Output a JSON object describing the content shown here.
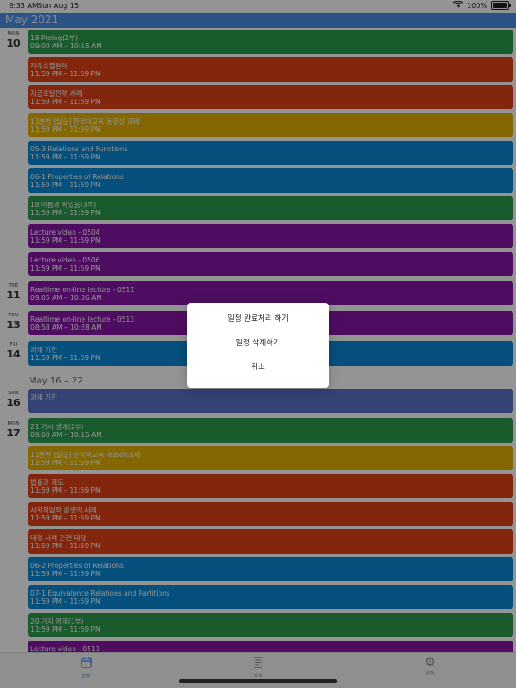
{
  "status_bar": {
    "time": "9:33 AM",
    "date": "Sun Aug 15",
    "battery": "100%"
  },
  "calendar": {
    "month_header": "May 2021",
    "week_header": "May 16 – 22",
    "days": [
      {
        "dow": "MON",
        "dom": "10"
      },
      {
        "dow": "TUE",
        "dom": "11"
      },
      {
        "dow": "THU",
        "dom": "13"
      },
      {
        "dow": "FRI",
        "dom": "14"
      },
      {
        "dow": "SUN",
        "dom": "16"
      },
      {
        "dow": "MON",
        "dom": "17"
      }
    ],
    "events": [
      {
        "title": "18 Prolog(2부)",
        "time": "09:00 AM – 10:15 AM",
        "color": "#2e9e4f"
      },
      {
        "title": "자유소멸원리",
        "time": "11:59 PM – 11:59 PM",
        "color": "#e04419"
      },
      {
        "title": "지금조달전략 사례",
        "time": "11:59 PM – 11:59 PM",
        "color": "#e04419"
      },
      {
        "title": "11분반 [실습] 한국어교육 동영상 과제",
        "time": "11:59 PM – 11:59 PM",
        "color": "#e3b100"
      },
      {
        "title": "05-3 Relations and Functions",
        "time": "11:59 PM – 11:59 PM",
        "color": "#0a89d6"
      },
      {
        "title": "06-1 Properties of Relations",
        "time": "11:59 PM – 11:59 PM",
        "color": "#0a89d6"
      },
      {
        "title": "18 아름과 비었음(3부)",
        "time": "11:59 PM – 11:59 PM",
        "color": "#2e9e4f"
      },
      {
        "title": "Lecture video - 0504",
        "time": "11:59 PM – 11:59 PM",
        "color": "#8817a8"
      },
      {
        "title": "Lecture video - 0506",
        "time": "11:59 PM – 11:59 PM",
        "color": "#8817a8"
      },
      {
        "title": "Realtime on-line lecture - 0511",
        "time": "09:05 AM – 10:36 AM",
        "color": "#8817a8"
      },
      {
        "title": "Realtime on-line lecture - 0513",
        "time": "08:58 AM – 10:28 AM",
        "color": "#8817a8"
      },
      {
        "title": "과제 기한",
        "time": "11:59 PM – 11:59 PM",
        "color": "#0a89d6"
      },
      {
        "title": "과제 기한",
        "time": "",
        "color": "#5c73c8"
      },
      {
        "title": "21 가시 생계(2부)",
        "time": "09:00 AM – 10:15 AM",
        "color": "#2e9e4f"
      },
      {
        "title": "11분반 [실습] 한국어교육 lesson과제",
        "time": "11:59 PM – 11:59 PM",
        "color": "#e3b100"
      },
      {
        "title": "법률과 제도",
        "time": "11:59 PM – 11:59 PM",
        "color": "#e04419"
      },
      {
        "title": "사회책임적 방생의 사례",
        "time": "11:59 PM – 11:59 PM",
        "color": "#e04419"
      },
      {
        "title": "대형 사례 관련 대담",
        "time": "11:59 PM – 11:59 PM",
        "color": "#e04419"
      },
      {
        "title": "06-2 Properties of Relations",
        "time": "11:59 PM – 11:59 PM",
        "color": "#0a89d6"
      },
      {
        "title": "07-1 Equivalence Relations and Partitions",
        "time": "11:59 PM – 11:59 PM",
        "color": "#0a89d6"
      },
      {
        "title": "20 가지 명제(1부)",
        "time": "11:59 PM – 11:59 PM",
        "color": "#2e9e4f"
      },
      {
        "title": "Lecture video - 0511",
        "time": "",
        "color": "#8817a8"
      }
    ]
  },
  "action_sheet": {
    "complete": "일정 완료처리 하기",
    "delete": "일정 삭제하기",
    "cancel": "취소"
  },
  "tab_bar": {
    "tabs": [
      {
        "label": "일정",
        "icon": "calendar-icon"
      },
      {
        "label": "과제",
        "icon": "document-icon"
      },
      {
        "label": "설정",
        "icon": "gear-icon"
      }
    ]
  }
}
